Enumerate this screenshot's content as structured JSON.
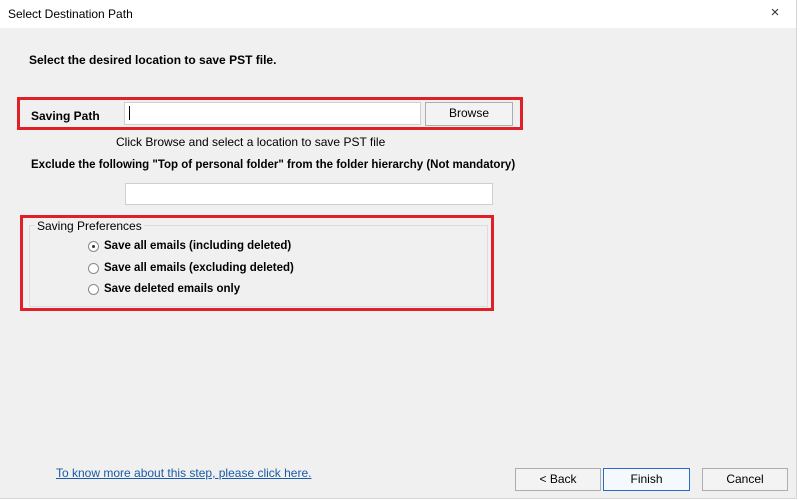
{
  "window": {
    "title": "Select Destination Path",
    "close_icon": "×"
  },
  "header": {
    "instruction": "Select the desired location to save PST file."
  },
  "saving_path": {
    "label": "Saving Path",
    "value": "",
    "browse_label": "Browse",
    "hint": "Click Browse and select a location to save PST file"
  },
  "exclude": {
    "label": "Exclude the following \"Top of personal folder\" from the folder hierarchy  (Not mandatory)",
    "value": ""
  },
  "preferences": {
    "title": "Saving Preferences",
    "options": [
      {
        "label": "Save all emails (including deleted)",
        "selected": true
      },
      {
        "label": "Save all emails (excluding deleted)",
        "selected": false
      },
      {
        "label": "Save deleted emails only",
        "selected": false
      }
    ]
  },
  "footer": {
    "help_link": "To know more about this step, please click here.",
    "back_label": "< Back",
    "finish_label": "Finish",
    "cancel_label": "Cancel"
  },
  "colors": {
    "highlight": "#e02027",
    "link": "#1a5aa6",
    "window_bg": "#f0f0f0"
  }
}
